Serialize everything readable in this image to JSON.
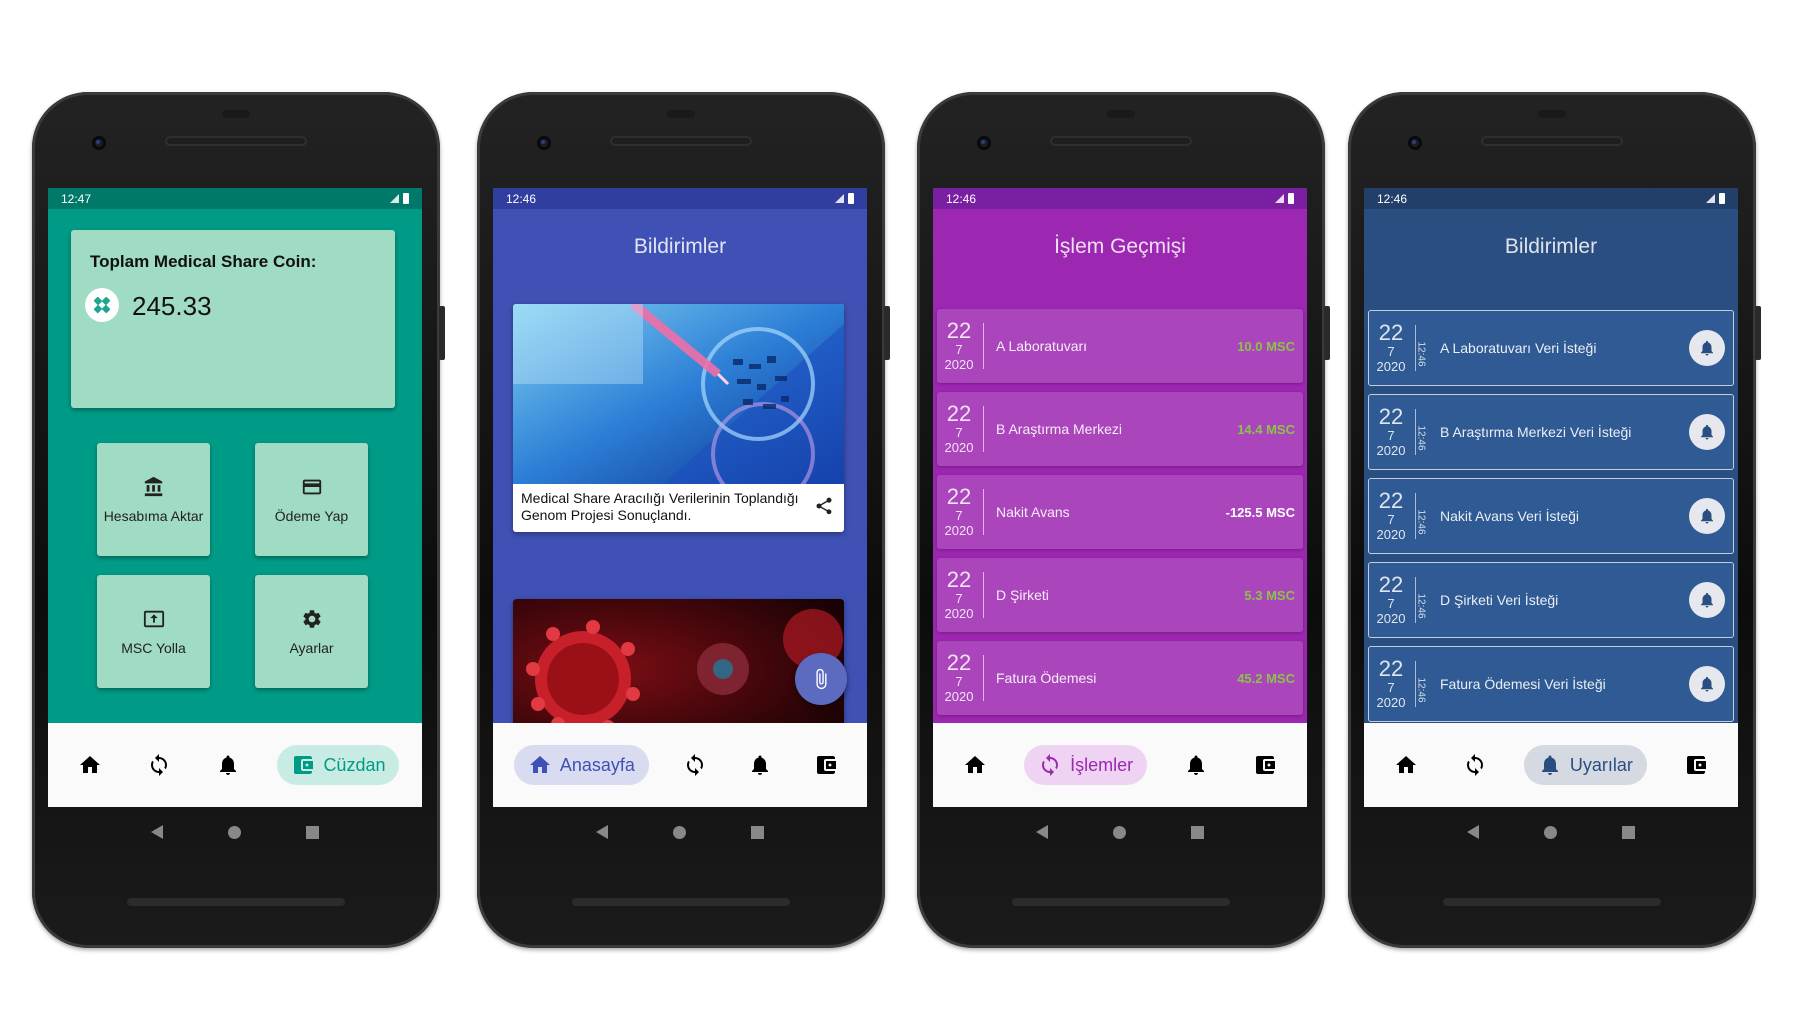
{
  "phones": [
    {
      "status_time": "12:47",
      "wallet": {
        "title": "Toplam Medical Share Coin:",
        "balance": "245.33",
        "actions": [
          "Hesabıma Aktar",
          "Ödeme Yap",
          "MSC Yolla",
          "Ayarlar"
        ]
      },
      "nav": {
        "active_label": "Cüzdan",
        "active_icon": "wallet-icon"
      }
    },
    {
      "status_time": "12:46",
      "title": "Bildirimler",
      "news": [
        {
          "caption": "Medical Share Aracılığı Verilerinin Toplandığı Genom Projesi Sonuçlandı.",
          "image": "lab-pipette-image"
        },
        {
          "caption": "",
          "image": "virus-image"
        }
      ],
      "nav": {
        "active_label": "Anasayfa",
        "active_icon": "home-icon"
      }
    },
    {
      "status_time": "12:46",
      "title": "İşlem Geçmişi",
      "transactions": [
        {
          "day": "22",
          "month": "7",
          "year": "2020",
          "label": "A Laboratuvarı",
          "amount": "10.0 MSC",
          "color": "#8bc34a"
        },
        {
          "day": "22",
          "month": "7",
          "year": "2020",
          "label": "B Araştırma Merkezi",
          "amount": "14.4 MSC",
          "color": "#8bc34a"
        },
        {
          "day": "22",
          "month": "7",
          "year": "2020",
          "label": "Nakit Avans",
          "amount": "-125.5 MSC",
          "color": "#ffffff"
        },
        {
          "day": "22",
          "month": "7",
          "year": "2020",
          "label": "D Şirketi",
          "amount": "5.3 MSC",
          "color": "#8bc34a"
        },
        {
          "day": "22",
          "month": "7",
          "year": "2020",
          "label": "Fatura Ödemesi",
          "amount": "45.2 MSC",
          "color": "#8bc34a"
        }
      ],
      "nav": {
        "active_label": "İşlemler",
        "active_icon": "sync-icon"
      }
    },
    {
      "status_time": "12:46",
      "title": "Bildirimler",
      "notifications": [
        {
          "day": "22",
          "month": "7",
          "year": "2020",
          "time": "12:46",
          "label": "A Laboratuvarı Veri İsteği"
        },
        {
          "day": "22",
          "month": "7",
          "year": "2020",
          "time": "12:46",
          "label": "B Araştırma Merkezi Veri İsteği"
        },
        {
          "day": "22",
          "month": "7",
          "year": "2020",
          "time": "12:46",
          "label": "Nakit Avans Veri İsteği"
        },
        {
          "day": "22",
          "month": "7",
          "year": "2020",
          "time": "12:46",
          "label": "D Şirketi Veri İsteği"
        },
        {
          "day": "22",
          "month": "7",
          "year": "2020",
          "time": "12:46",
          "label": "Fatura Ödemesi Veri İsteği"
        }
      ],
      "nav": {
        "active_label": "Uyarılar",
        "active_icon": "bell-icon"
      }
    }
  ],
  "theme": {
    "wallet_bg": "#009b86",
    "wallet_status": "#00796b",
    "news_bg": "#3f51b5",
    "news_status": "#303f9f",
    "history_bg": "#9c27b0",
    "history_status": "#7b1fa2",
    "notif_bg": "#2a4e80",
    "notif_status": "#223f69"
  }
}
